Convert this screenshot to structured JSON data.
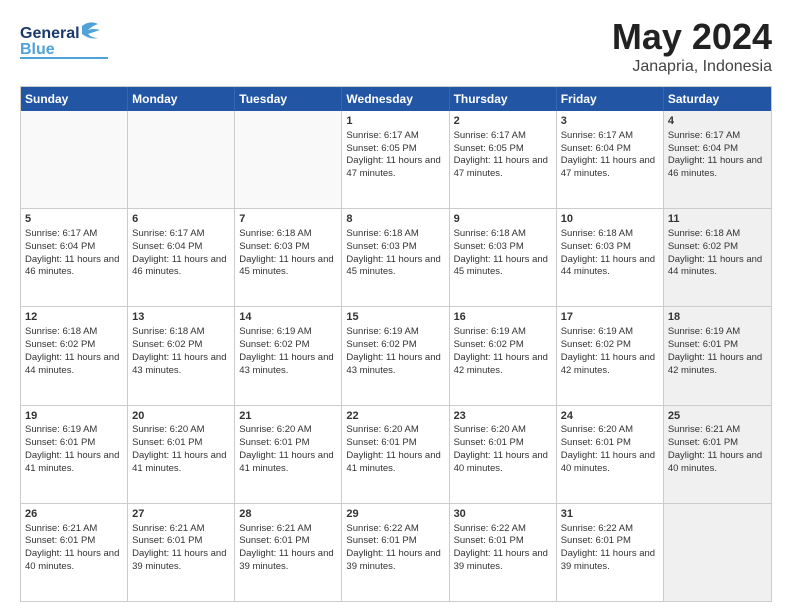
{
  "header": {
    "logo_line1": "General",
    "logo_line2": "Blue",
    "month": "May 2024",
    "location": "Janapria, Indonesia"
  },
  "weekdays": [
    "Sunday",
    "Monday",
    "Tuesday",
    "Wednesday",
    "Thursday",
    "Friday",
    "Saturday"
  ],
  "rows": [
    [
      {
        "day": "",
        "empty": true
      },
      {
        "day": "",
        "empty": true
      },
      {
        "day": "",
        "empty": true
      },
      {
        "day": "1",
        "sunrise": "6:17 AM",
        "sunset": "6:05 PM",
        "daylight": "11 hours and 47 minutes."
      },
      {
        "day": "2",
        "sunrise": "6:17 AM",
        "sunset": "6:05 PM",
        "daylight": "11 hours and 47 minutes."
      },
      {
        "day": "3",
        "sunrise": "6:17 AM",
        "sunset": "6:04 PM",
        "daylight": "11 hours and 47 minutes."
      },
      {
        "day": "4",
        "sunrise": "6:17 AM",
        "sunset": "6:04 PM",
        "daylight": "11 hours and 46 minutes.",
        "shaded": true
      }
    ],
    [
      {
        "day": "5",
        "sunrise": "6:17 AM",
        "sunset": "6:04 PM",
        "daylight": "11 hours and 46 minutes."
      },
      {
        "day": "6",
        "sunrise": "6:17 AM",
        "sunset": "6:04 PM",
        "daylight": "11 hours and 46 minutes."
      },
      {
        "day": "7",
        "sunrise": "6:18 AM",
        "sunset": "6:03 PM",
        "daylight": "11 hours and 45 minutes."
      },
      {
        "day": "8",
        "sunrise": "6:18 AM",
        "sunset": "6:03 PM",
        "daylight": "11 hours and 45 minutes."
      },
      {
        "day": "9",
        "sunrise": "6:18 AM",
        "sunset": "6:03 PM",
        "daylight": "11 hours and 45 minutes."
      },
      {
        "day": "10",
        "sunrise": "6:18 AM",
        "sunset": "6:03 PM",
        "daylight": "11 hours and 44 minutes."
      },
      {
        "day": "11",
        "sunrise": "6:18 AM",
        "sunset": "6:02 PM",
        "daylight": "11 hours and 44 minutes.",
        "shaded": true
      }
    ],
    [
      {
        "day": "12",
        "sunrise": "6:18 AM",
        "sunset": "6:02 PM",
        "daylight": "11 hours and 44 minutes."
      },
      {
        "day": "13",
        "sunrise": "6:18 AM",
        "sunset": "6:02 PM",
        "daylight": "11 hours and 43 minutes."
      },
      {
        "day": "14",
        "sunrise": "6:19 AM",
        "sunset": "6:02 PM",
        "daylight": "11 hours and 43 minutes."
      },
      {
        "day": "15",
        "sunrise": "6:19 AM",
        "sunset": "6:02 PM",
        "daylight": "11 hours and 43 minutes."
      },
      {
        "day": "16",
        "sunrise": "6:19 AM",
        "sunset": "6:02 PM",
        "daylight": "11 hours and 42 minutes."
      },
      {
        "day": "17",
        "sunrise": "6:19 AM",
        "sunset": "6:02 PM",
        "daylight": "11 hours and 42 minutes."
      },
      {
        "day": "18",
        "sunrise": "6:19 AM",
        "sunset": "6:01 PM",
        "daylight": "11 hours and 42 minutes.",
        "shaded": true
      }
    ],
    [
      {
        "day": "19",
        "sunrise": "6:19 AM",
        "sunset": "6:01 PM",
        "daylight": "11 hours and 41 minutes."
      },
      {
        "day": "20",
        "sunrise": "6:20 AM",
        "sunset": "6:01 PM",
        "daylight": "11 hours and 41 minutes."
      },
      {
        "day": "21",
        "sunrise": "6:20 AM",
        "sunset": "6:01 PM",
        "daylight": "11 hours and 41 minutes."
      },
      {
        "day": "22",
        "sunrise": "6:20 AM",
        "sunset": "6:01 PM",
        "daylight": "11 hours and 41 minutes."
      },
      {
        "day": "23",
        "sunrise": "6:20 AM",
        "sunset": "6:01 PM",
        "daylight": "11 hours and 40 minutes."
      },
      {
        "day": "24",
        "sunrise": "6:20 AM",
        "sunset": "6:01 PM",
        "daylight": "11 hours and 40 minutes."
      },
      {
        "day": "25",
        "sunrise": "6:21 AM",
        "sunset": "6:01 PM",
        "daylight": "11 hours and 40 minutes.",
        "shaded": true
      }
    ],
    [
      {
        "day": "26",
        "sunrise": "6:21 AM",
        "sunset": "6:01 PM",
        "daylight": "11 hours and 40 minutes."
      },
      {
        "day": "27",
        "sunrise": "6:21 AM",
        "sunset": "6:01 PM",
        "daylight": "11 hours and 39 minutes."
      },
      {
        "day": "28",
        "sunrise": "6:21 AM",
        "sunset": "6:01 PM",
        "daylight": "11 hours and 39 minutes."
      },
      {
        "day": "29",
        "sunrise": "6:22 AM",
        "sunset": "6:01 PM",
        "daylight": "11 hours and 39 minutes."
      },
      {
        "day": "30",
        "sunrise": "6:22 AM",
        "sunset": "6:01 PM",
        "daylight": "11 hours and 39 minutes."
      },
      {
        "day": "31",
        "sunrise": "6:22 AM",
        "sunset": "6:01 PM",
        "daylight": "11 hours and 39 minutes."
      },
      {
        "day": "",
        "empty": true,
        "shaded": true
      }
    ]
  ]
}
